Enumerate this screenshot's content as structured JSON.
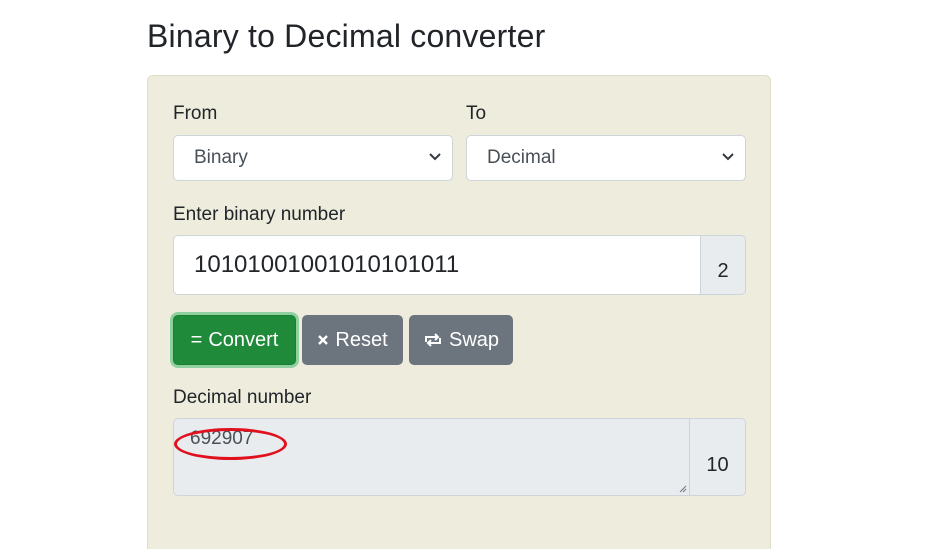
{
  "page": {
    "title": "Binary to Decimal converter"
  },
  "form": {
    "from_label": "From",
    "from_value": "Binary",
    "to_label": "To",
    "to_value": "Decimal",
    "input_label": "Enter binary number",
    "input_value": "10101001001010101011",
    "input_base": "2",
    "result_label": "Decimal number",
    "result_value": "692907",
    "result_base": "10"
  },
  "buttons": {
    "convert": {
      "icon": "=",
      "label": "Convert"
    },
    "reset": {
      "icon": "times-icon",
      "label": "Reset"
    },
    "swap": {
      "icon": "swap-icon",
      "label": "Swap"
    }
  },
  "colors": {
    "panel": "#eeecdd",
    "convert_button": "#1e8a3a",
    "gray_button": "#6c757d",
    "annotation": "#e0101e"
  }
}
